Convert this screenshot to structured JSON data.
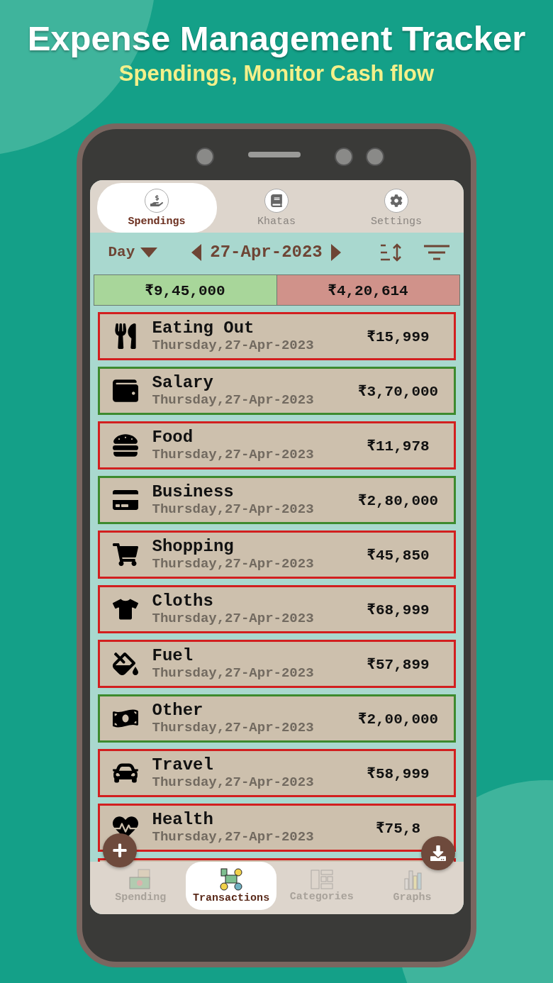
{
  "headline": {
    "title": "Expense Management Tracker",
    "subtitle": "Spendings, Monitor Cash flow"
  },
  "top_tabs": [
    {
      "label": "Spendings",
      "selected": true
    },
    {
      "label": "Khatas",
      "selected": false
    },
    {
      "label": "Settings",
      "selected": false
    }
  ],
  "toolbar": {
    "period": "Day",
    "date": "27-Apr-2023"
  },
  "totals": {
    "income": "₹9,45,000",
    "expense": "₹4,20,614"
  },
  "transactions": [
    {
      "kind": "expense",
      "name": "Eating Out",
      "date": "Thursday,27-Apr-2023",
      "amount": "₹15,999"
    },
    {
      "kind": "income",
      "name": "Salary",
      "date": "Thursday,27-Apr-2023",
      "amount": "₹3,70,000"
    },
    {
      "kind": "expense",
      "name": "Food",
      "date": "Thursday,27-Apr-2023",
      "amount": "₹11,978"
    },
    {
      "kind": "income",
      "name": "Business",
      "date": "Thursday,27-Apr-2023",
      "amount": "₹2,80,000"
    },
    {
      "kind": "expense",
      "name": "Shopping",
      "date": "Thursday,27-Apr-2023",
      "amount": "₹45,850"
    },
    {
      "kind": "expense",
      "name": "Cloths",
      "date": "Thursday,27-Apr-2023",
      "amount": "₹68,999"
    },
    {
      "kind": "expense",
      "name": "Fuel",
      "date": "Thursday,27-Apr-2023",
      "amount": "₹57,899"
    },
    {
      "kind": "income",
      "name": "Other",
      "date": "Thursday,27-Apr-2023",
      "amount": "₹2,00,000"
    },
    {
      "kind": "expense",
      "name": "Travel",
      "date": "Thursday,27-Apr-2023",
      "amount": "₹58,999"
    },
    {
      "kind": "expense",
      "name": "Health",
      "date": "Thursday,27-Apr-2023",
      "amount": "₹75,8"
    },
    {
      "kind": "expense"
    }
  ],
  "bottom_nav": [
    {
      "label": "Spending",
      "selected": false
    },
    {
      "label": "Transactions",
      "selected": true
    },
    {
      "label": "Categories",
      "selected": false
    },
    {
      "label": "Graphs",
      "selected": false
    }
  ]
}
